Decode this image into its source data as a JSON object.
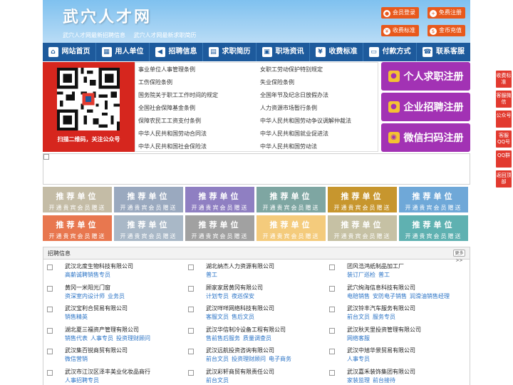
{
  "header": {
    "logo": "武穴人才网",
    "taglines": [
      "武穴人才网最新招聘信息",
      "武穴人才网最新求职简历"
    ],
    "buttons": {
      "member_login": "会员登录",
      "free_register": "免费注册",
      "fee_standard": "收费标准",
      "gold_recharge": "金币充值"
    }
  },
  "nav": [
    {
      "label": "网站首页",
      "icon": "home-icon"
    },
    {
      "label": "用人单位",
      "icon": "building-icon"
    },
    {
      "label": "招聘信息",
      "icon": "megaphone-icon"
    },
    {
      "label": "求职简历",
      "icon": "resume-icon"
    },
    {
      "label": "职场资讯",
      "icon": "news-icon"
    },
    {
      "label": "收费标准",
      "icon": "coin-icon"
    },
    {
      "label": "付款方式",
      "icon": "card-icon"
    },
    {
      "label": "联系客服",
      "icon": "phone-icon"
    }
  ],
  "qr": {
    "caption": "扫描二维码，关注公众号"
  },
  "links": [
    "事业单位人事管理条例",
    "女职工劳动保护特别规定",
    "工伤保险条例",
    "失业保险条例",
    "国务院关于职工工作时间的规定",
    "全国年节及纪念日放假办法",
    "全国社会保障基金条例",
    "人力资源市场暂行条例",
    "保障农民工工资支付条例",
    "中华人民共和国劳动争议调解仲裁法",
    "中华人民共和国劳动合同法",
    "中华人民共和国就业促进法",
    "中华人民共和国社会保险法",
    "中华人民共和国劳动法"
  ],
  "register": {
    "personal": "个人求职注册",
    "company": "企业招聘注册",
    "wechat": "微信扫码注册"
  },
  "tiles": {
    "title": "推荐单位",
    "subtitle": "开通贵宾会员赠送",
    "colors": [
      "#c4bca6",
      "#9aa9bf",
      "#8f7fc2",
      "#7ea6a2",
      "#c7962e",
      "#6fa8d8",
      "#e8774f",
      "#a9b8c7",
      "#a1a1a1",
      "#f4cb7c",
      "#c6c1a4",
      "#5fb1b1"
    ]
  },
  "section": {
    "title": "招聘信息",
    "more": "更多>>"
  },
  "jobs": [
    {
      "company": "武汉北度生物科技有限公司",
      "positions": [
        "高薪诚聘销售专员"
      ]
    },
    {
      "company": "湖北纳杰人力资源有限公司",
      "positions": [
        "普工"
      ]
    },
    {
      "company": "团风浩鸿纸制品加工厂",
      "positions": [
        "装订厂巡检",
        "普工"
      ]
    },
    {
      "company": "黄冈一米阳光门窗",
      "positions": [
        "资深室内设计师",
        "业务员"
      ]
    },
    {
      "company": "顾家家居黄冈有限公司",
      "positions": [
        "计划专员",
        "夜巡保安"
      ]
    },
    {
      "company": "武穴绚海信息科技有限公司",
      "positions": [
        "电赔销售",
        "安防电子销售",
        "润滑油销售经理"
      ]
    },
    {
      "company": "武汉宝利合贸易有限公司",
      "positions": [
        "销售精英"
      ]
    },
    {
      "company": "武汉咩咩网络科技有限公司",
      "positions": [
        "客服文员",
        "售后文员"
      ]
    },
    {
      "company": "武汉铃丰汽车服务有限公司",
      "positions": [
        "前台文员",
        "服务专员"
      ]
    },
    {
      "company": "湖北夏三福资产管理有限公司",
      "positions": [
        "销售代表",
        "人事专员",
        "投资理财顾问"
      ]
    },
    {
      "company": "武汉华信制冷设备工程有限公司",
      "positions": [
        "售前售后服务",
        "质量调查员"
      ]
    },
    {
      "company": "武汉秋天里投资管理有限公司",
      "positions": [
        "网络客服"
      ]
    },
    {
      "company": "武汉集百锐商贸有限公司",
      "positions": [
        "微信营销"
      ]
    },
    {
      "company": "武汉远航投资咨询有限公司",
      "positions": [
        "前台文员",
        "投资理财顾问",
        "电子商务"
      ]
    },
    {
      "company": "武汉中旭华景贸易有限公司",
      "positions": [
        "人事专员"
      ]
    },
    {
      "company": "武汉市江汉区泽丰美业化妆品商行",
      "positions": [
        "人事招聘专员"
      ]
    },
    {
      "company": "武汉彩轩商贸有限责任公司",
      "positions": [
        "前台文员"
      ]
    },
    {
      "company": "武汉嘉禾装饰集团有限公司",
      "positions": [
        "家装监理",
        "前台接待"
      ]
    }
  ],
  "side": [
    {
      "label": "收费标准"
    },
    {
      "label": "客服微信"
    },
    {
      "label": "公众号"
    },
    {
      "label": "客服QQ号"
    },
    {
      "label": "QQ群"
    },
    {
      "label": "返回顶部"
    }
  ]
}
